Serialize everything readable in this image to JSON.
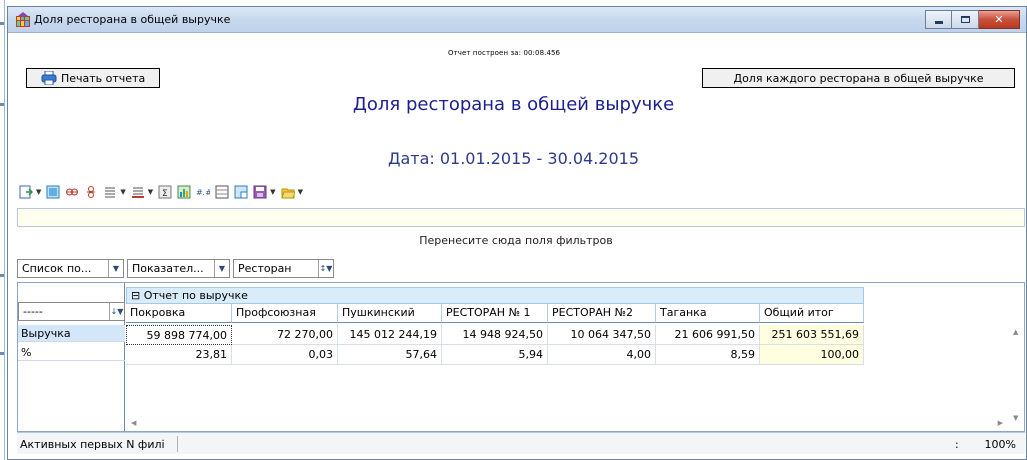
{
  "window": {
    "title": "Доля ресторана в общей выручке",
    "buttons": {
      "minimize": "minimize",
      "maximize": "maximize",
      "close": "close"
    }
  },
  "report": {
    "built_time": "Отчет построен за: 00:08.456",
    "print_button": "Печать отчета",
    "share_button": "Доля каждого ресторана в общей выручке",
    "title": "Доля ресторана в общей выручке",
    "date_range": "Дата: 01.01.2015 - 30.04.2015"
  },
  "toolbar": {
    "icons": [
      "export-icon",
      "table-layout-icon",
      "link-icon",
      "unlink-icon",
      "align-icon",
      "border-icon",
      "sum-icon",
      "chart-icon",
      "number-format-icon",
      "grid-icon",
      "filter-icon",
      "save-icon",
      "open-folder-icon"
    ]
  },
  "filter_area": {
    "hint": "Перенесите сюда поля фильтров"
  },
  "fields": {
    "list": "Список по...",
    "indicator": "Показател...",
    "restaurant": "Ресторан",
    "row_dropdown": "-----"
  },
  "grid": {
    "header": "Отчет по выручке",
    "header_collapse": "⊟",
    "columns": [
      "Покровка",
      "Профсоюзная",
      "Пушкинский",
      "РЕСТОРАН № 1",
      "РЕСТОРАН №2",
      "Таганка",
      "Общий итог"
    ],
    "rows": [
      {
        "label": "Выручка",
        "values": [
          "59 898 774,00",
          "72 270,00",
          "145 012 244,19",
          "14 948 924,50",
          "10 064 347,50",
          "21 606 991,50",
          "251 603 551,69"
        ]
      },
      {
        "label": "%",
        "values": [
          "23,81",
          "0,03",
          "57,64",
          "5,94",
          "4,00",
          "8,59",
          "100,00"
        ]
      }
    ]
  },
  "status": {
    "left": "Активных первых N филі",
    "colon": ":",
    "zoom": "100%"
  },
  "colors": {
    "title_blue": "#1c1f8c",
    "header_blue": "#d8ecfa",
    "total_yellow": "#fffee0",
    "selection_blue": "#d4e6fa"
  }
}
